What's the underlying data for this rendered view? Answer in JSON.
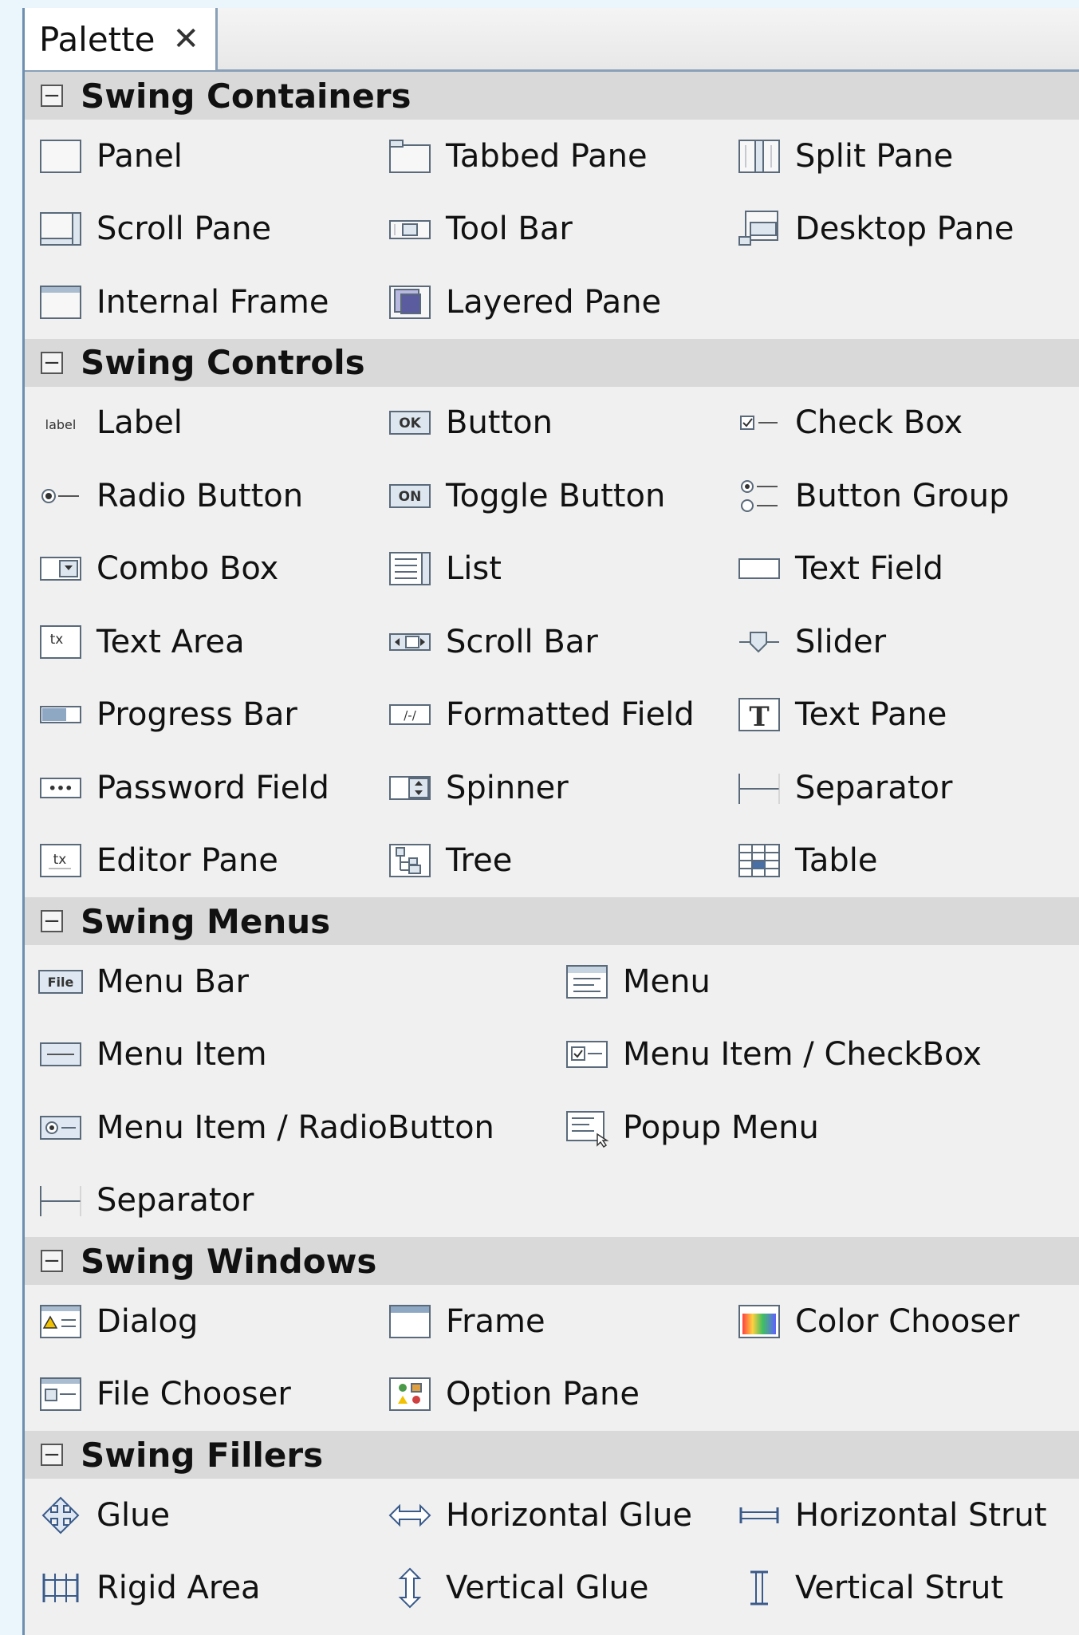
{
  "palette": {
    "tab": {
      "title": "Palette",
      "close_glyph": "✕"
    },
    "categories": [
      {
        "label": "Swing Containers",
        "collapse_glyph": "−",
        "columns": 3,
        "items": [
          {
            "label": "Panel",
            "icon": "panel-icon"
          },
          {
            "label": "Tabbed Pane",
            "icon": "tabbed-pane-icon"
          },
          {
            "label": "Split Pane",
            "icon": "split-pane-icon"
          },
          {
            "label": "Scroll Pane",
            "icon": "scroll-pane-icon"
          },
          {
            "label": "Tool Bar",
            "icon": "tool-bar-icon"
          },
          {
            "label": "Desktop Pane",
            "icon": "desktop-pane-icon"
          },
          {
            "label": "Internal Frame",
            "icon": "internal-frame-icon"
          },
          {
            "label": "Layered Pane",
            "icon": "layered-pane-icon"
          }
        ]
      },
      {
        "label": "Swing Controls",
        "collapse_glyph": "−",
        "columns": 3,
        "items": [
          {
            "label": "Label",
            "icon": "label-icon",
            "icon_text": "label"
          },
          {
            "label": "Button",
            "icon": "button-icon",
            "icon_text": "OK"
          },
          {
            "label": "Check Box",
            "icon": "check-box-icon"
          },
          {
            "label": "Radio Button",
            "icon": "radio-button-icon"
          },
          {
            "label": "Toggle Button",
            "icon": "toggle-button-icon",
            "icon_text": "ON"
          },
          {
            "label": "Button Group",
            "icon": "button-group-icon"
          },
          {
            "label": "Combo Box",
            "icon": "combo-box-icon"
          },
          {
            "label": "List",
            "icon": "list-icon"
          },
          {
            "label": "Text Field",
            "icon": "text-field-icon"
          },
          {
            "label": "Text Area",
            "icon": "text-area-icon",
            "icon_text": "tx"
          },
          {
            "label": "Scroll Bar",
            "icon": "scroll-bar-icon"
          },
          {
            "label": "Slider",
            "icon": "slider-icon"
          },
          {
            "label": "Progress Bar",
            "icon": "progress-bar-icon"
          },
          {
            "label": "Formatted Field",
            "icon": "formatted-field-icon",
            "icon_text": "/-/"
          },
          {
            "label": "Text Pane",
            "icon": "text-pane-icon",
            "icon_text": "T"
          },
          {
            "label": "Password Field",
            "icon": "password-field-icon",
            "icon_text": "•••"
          },
          {
            "label": "Spinner",
            "icon": "spinner-icon"
          },
          {
            "label": "Separator",
            "icon": "separator-icon"
          },
          {
            "label": "Editor Pane",
            "icon": "editor-pane-icon",
            "icon_text": "tx"
          },
          {
            "label": "Tree",
            "icon": "tree-icon"
          },
          {
            "label": "Table",
            "icon": "table-icon"
          }
        ]
      },
      {
        "label": "Swing Menus",
        "collapse_glyph": "−",
        "columns": 2,
        "items": [
          {
            "label": "Menu Bar",
            "icon": "menu-bar-icon",
            "icon_text": "File"
          },
          {
            "label": "Menu",
            "icon": "menu-icon"
          },
          {
            "label": "Menu Item",
            "icon": "menu-item-icon"
          },
          {
            "label": "Menu Item / CheckBox",
            "icon": "menu-item-checkbox-icon"
          },
          {
            "label": "Menu Item / RadioButton",
            "icon": "menu-item-radiobutton-icon"
          },
          {
            "label": "Popup Menu",
            "icon": "popup-menu-icon"
          },
          {
            "label": "Separator",
            "icon": "separator-icon"
          }
        ]
      },
      {
        "label": "Swing Windows",
        "collapse_glyph": "−",
        "columns": 3,
        "items": [
          {
            "label": "Dialog",
            "icon": "dialog-icon"
          },
          {
            "label": "Frame",
            "icon": "frame-icon"
          },
          {
            "label": "Color Chooser",
            "icon": "color-chooser-icon"
          },
          {
            "label": "File Chooser",
            "icon": "file-chooser-icon"
          },
          {
            "label": "Option Pane",
            "icon": "option-pane-icon"
          }
        ]
      },
      {
        "label": "Swing Fillers",
        "collapse_glyph": "−",
        "columns": 3,
        "items": [
          {
            "label": "Glue",
            "icon": "glue-icon"
          },
          {
            "label": "Horizontal Glue",
            "icon": "horizontal-glue-icon"
          },
          {
            "label": "Horizontal Strut",
            "icon": "horizontal-strut-icon"
          },
          {
            "label": "Rigid Area",
            "icon": "rigid-area-icon"
          },
          {
            "label": "Vertical Glue",
            "icon": "vertical-glue-icon"
          },
          {
            "label": "Vertical Strut",
            "icon": "vertical-strut-icon"
          }
        ]
      }
    ]
  }
}
